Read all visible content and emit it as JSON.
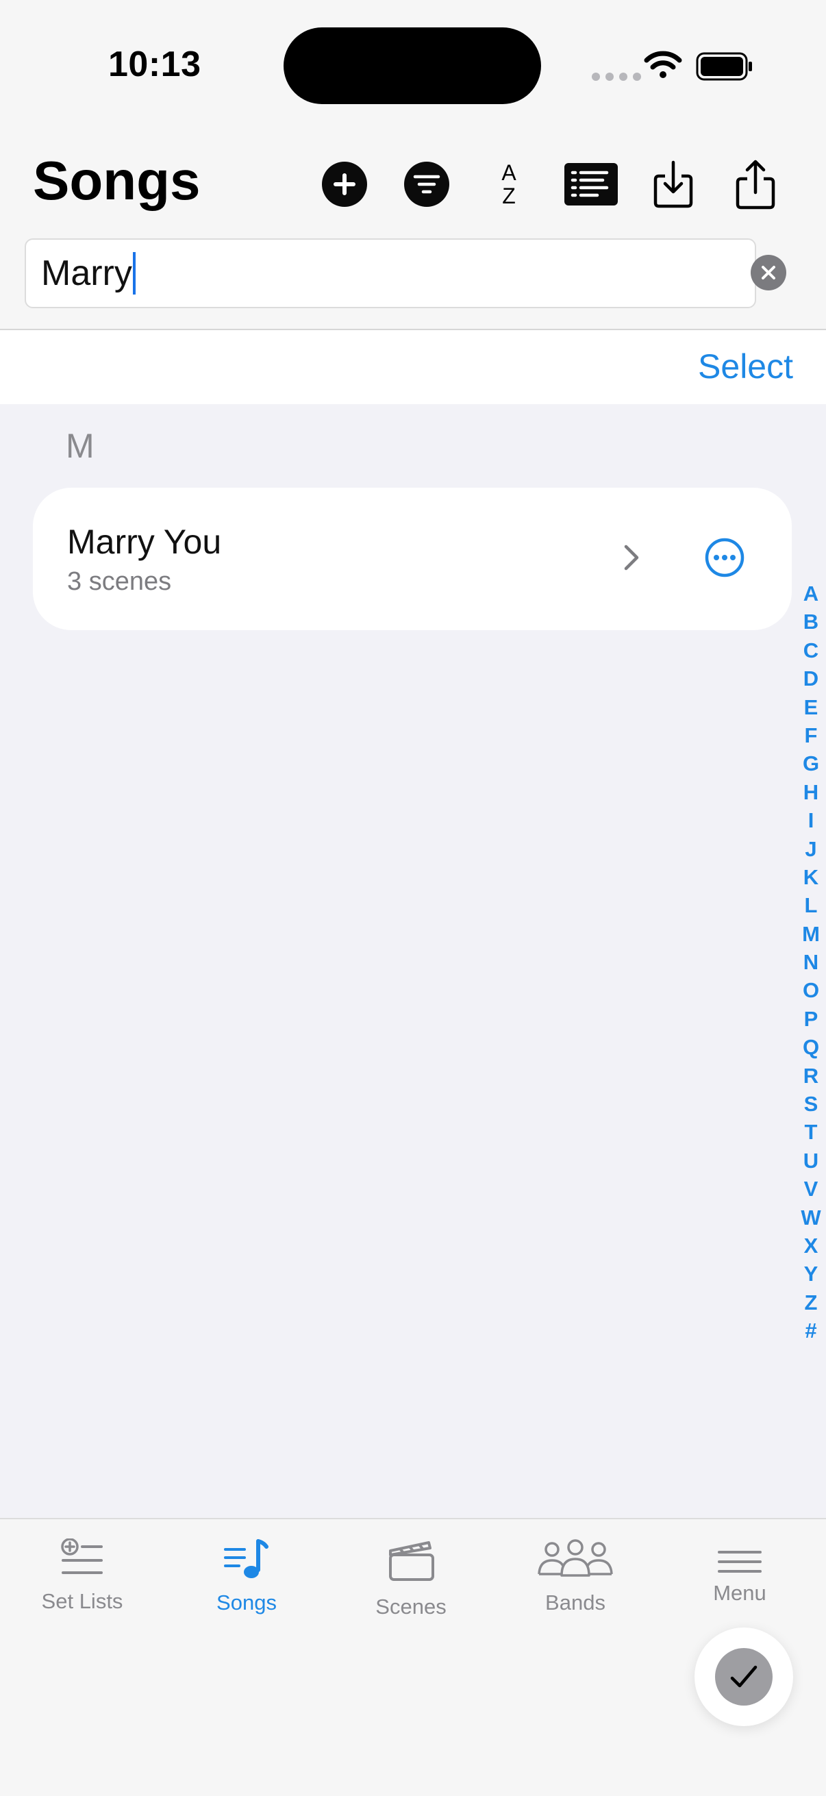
{
  "status_bar": {
    "time": "10:13"
  },
  "header": {
    "title": "Songs",
    "sort_icon_top": "A",
    "sort_icon_bottom": "Z"
  },
  "search": {
    "value": "Marry"
  },
  "select_label": "Select",
  "section": {
    "letter": "M"
  },
  "songs": [
    {
      "title": "Marry You",
      "subtitle": "3 scenes"
    }
  ],
  "index_letters": [
    "A",
    "B",
    "C",
    "D",
    "E",
    "F",
    "G",
    "H",
    "I",
    "J",
    "K",
    "L",
    "M",
    "N",
    "O",
    "P",
    "Q",
    "R",
    "S",
    "T",
    "U",
    "V",
    "W",
    "X",
    "Y",
    "Z",
    "#"
  ],
  "tabs": [
    {
      "label": "Set Lists",
      "icon": "set-lists-icon"
    },
    {
      "label": "Songs",
      "icon": "songs-icon",
      "active": true
    },
    {
      "label": "Scenes",
      "icon": "scenes-icon"
    },
    {
      "label": "Bands",
      "icon": "bands-icon"
    },
    {
      "label": "Menu",
      "icon": "menu-icon"
    }
  ],
  "colors": {
    "accent": "#1e88e5",
    "inactive": "#8a8a8e"
  }
}
